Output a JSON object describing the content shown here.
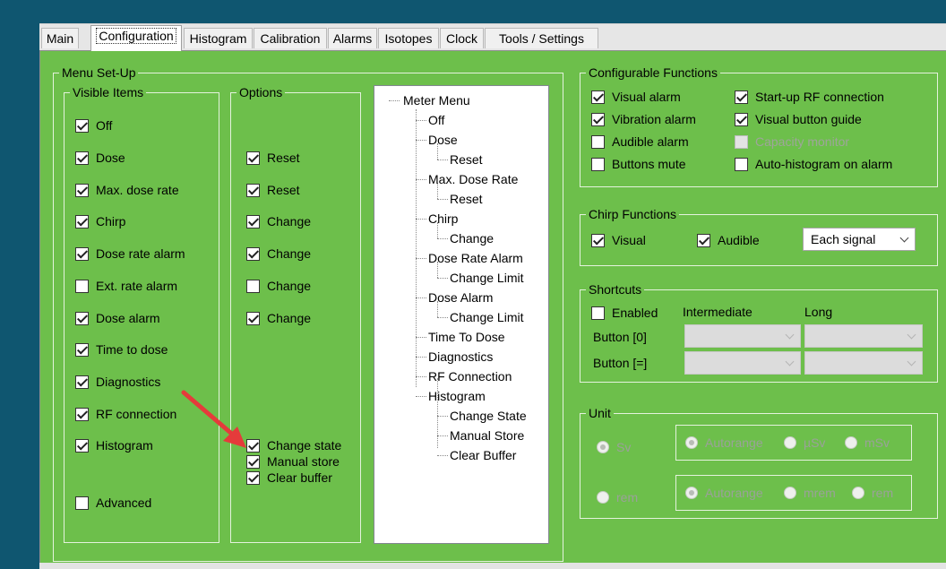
{
  "tabs": [
    "Main",
    "Configuration",
    "Histogram",
    "Calibration",
    "Alarms",
    "Isotopes",
    "Clock",
    "Tools / Settings"
  ],
  "active_tab": "Configuration",
  "menu_setup": {
    "title": "Menu Set-Up",
    "visible_items": {
      "title": "Visible Items",
      "items": [
        {
          "label": "Off",
          "checked": true
        },
        {
          "label": "Dose",
          "checked": true
        },
        {
          "label": "Max. dose rate",
          "checked": true
        },
        {
          "label": "Chirp",
          "checked": true
        },
        {
          "label": "Dose rate alarm",
          "checked": true
        },
        {
          "label": "Ext. rate alarm",
          "checked": false
        },
        {
          "label": "Dose alarm",
          "checked": true
        },
        {
          "label": "Time to dose",
          "checked": true
        },
        {
          "label": "Diagnostics",
          "checked": true
        },
        {
          "label": "RF connection",
          "checked": true
        },
        {
          "label": "Histogram",
          "checked": true
        },
        {
          "label": "Advanced",
          "checked": false
        }
      ]
    },
    "options": {
      "title": "Options",
      "items": [
        {
          "label": "Reset",
          "checked": true
        },
        {
          "label": "Reset",
          "checked": true
        },
        {
          "label": "Change",
          "checked": true
        },
        {
          "label": "Change",
          "checked": true
        },
        {
          "label": "Change",
          "checked": false
        },
        {
          "label": "Change",
          "checked": true
        },
        {
          "label": "Change state",
          "checked": true
        },
        {
          "label": "Manual store",
          "checked": true
        },
        {
          "label": "Clear buffer",
          "checked": true
        }
      ]
    },
    "tree": {
      "root": "Meter Menu",
      "nodes": [
        "Off",
        "Dose",
        "Reset",
        "Max. Dose Rate",
        "Reset",
        "Chirp",
        "Change",
        "Dose Rate Alarm",
        "Change Limit",
        "Dose Alarm",
        "Change Limit",
        "Time To Dose",
        "Diagnostics",
        "RF Connection",
        "Histogram",
        "Change State",
        "Manual Store",
        "Clear Buffer"
      ]
    }
  },
  "configurable_functions": {
    "title": "Configurable Functions",
    "items": [
      {
        "label": "Visual alarm",
        "checked": true,
        "enabled": true
      },
      {
        "label": "Start-up RF connection",
        "checked": true,
        "enabled": true
      },
      {
        "label": "Vibration alarm",
        "checked": true,
        "enabled": true
      },
      {
        "label": "Visual button guide",
        "checked": true,
        "enabled": true
      },
      {
        "label": "Audible alarm",
        "checked": false,
        "enabled": true
      },
      {
        "label": "Capacity monitor",
        "checked": false,
        "enabled": false
      },
      {
        "label": "Buttons mute",
        "checked": false,
        "enabled": true
      },
      {
        "label": "Auto-histogram on alarm",
        "checked": false,
        "enabled": true
      }
    ]
  },
  "chirp_functions": {
    "title": "Chirp Functions",
    "visual": {
      "label": "Visual",
      "checked": true
    },
    "audible": {
      "label": "Audible",
      "checked": true
    },
    "mode_select": "Each signal"
  },
  "shortcuts": {
    "title": "Shortcuts",
    "enabled": {
      "label": "Enabled",
      "checked": false
    },
    "col_intermediate": "Intermediate",
    "col_long": "Long",
    "button0": "Button [0]",
    "button_eq": "Button [=]"
  },
  "unit": {
    "title": "Unit",
    "sv": "Sv",
    "rem": "rem",
    "sv_ranges": [
      "Autorange",
      "µSv",
      "mSv"
    ],
    "rem_ranges": [
      "Autorange",
      "mrem",
      "rem"
    ]
  },
  "colors": {
    "panel": "#6dbf4b",
    "background": "#0f5670",
    "arrow": "#e53b3b"
  }
}
